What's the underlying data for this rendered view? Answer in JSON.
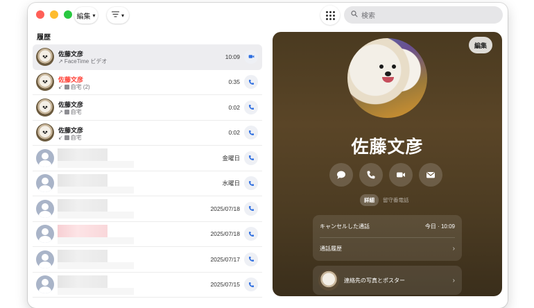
{
  "toolbar": {
    "edit_menu_label": "編集",
    "search_placeholder": "検索"
  },
  "sidebar": {
    "section_title": "履歴",
    "rows": [
      {
        "name": "佐藤文彦",
        "sub": "↗ FaceTime ビデオ",
        "time": "10:09",
        "call_type": "video",
        "missed": false,
        "avatar": "dog",
        "redacted": false
      },
      {
        "name": "佐藤文彦",
        "sub": "自宅 (2)",
        "time": "0:35",
        "call_type": "phone",
        "missed": true,
        "avatar": "dog",
        "redacted": false
      },
      {
        "name": "佐藤文彦",
        "sub": "自宅",
        "time": "0:02",
        "call_type": "phone",
        "missed": false,
        "avatar": "dog",
        "redacted": false
      },
      {
        "name": "佐藤文彦",
        "sub": "自宅",
        "time": "0:02",
        "call_type": "phone",
        "missed": false,
        "avatar": "dog",
        "redacted": false
      },
      {
        "name": "",
        "sub": "",
        "time": "金曜日",
        "call_type": "phone",
        "missed": false,
        "avatar": "generic",
        "redacted": true
      },
      {
        "name": "",
        "sub": "",
        "time": "水曜日",
        "call_type": "phone",
        "missed": false,
        "avatar": "generic",
        "redacted": true
      },
      {
        "name": "",
        "sub": "",
        "time": "2025/07/18",
        "call_type": "phone",
        "missed": false,
        "avatar": "generic",
        "redacted": true
      },
      {
        "name": "",
        "sub": "",
        "time": "2025/07/18",
        "call_type": "phone",
        "missed": true,
        "avatar": "generic",
        "redacted": true
      },
      {
        "name": "",
        "sub": "",
        "time": "2025/07/17",
        "call_type": "phone",
        "missed": false,
        "avatar": "generic",
        "redacted": true
      },
      {
        "name": "",
        "sub": "",
        "time": "2025/07/15",
        "call_type": "phone",
        "missed": false,
        "avatar": "generic",
        "redacted": true
      }
    ]
  },
  "detail": {
    "edit_label": "編集",
    "contact_name": "佐藤文彦",
    "segments": [
      "詳細",
      "留守番電話"
    ],
    "cancelled_call_label": "キャンセルした通話",
    "cancelled_call_time": "今日 · 10:09",
    "call_history_label": "通話履歴",
    "photo_poster_label": "連絡先の写真とポスター"
  },
  "colors": {
    "accent": "#2f6fe0",
    "missed": "#ff3b30",
    "detail_bg": "#4a3a20"
  }
}
